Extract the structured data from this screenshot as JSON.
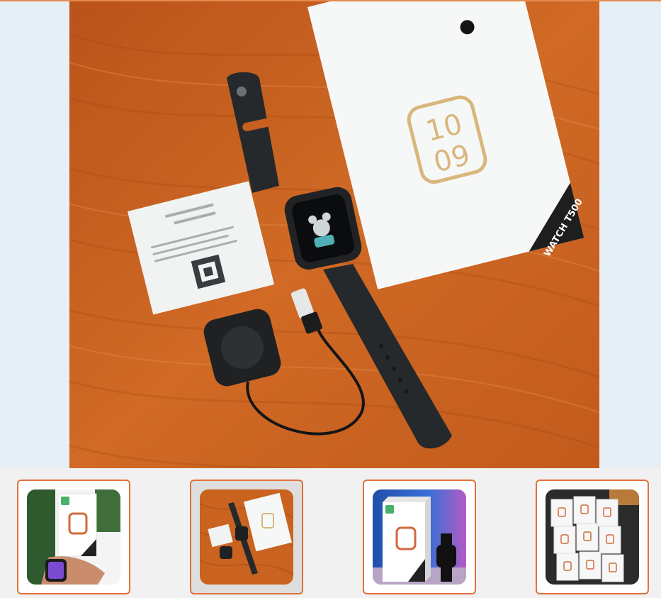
{
  "gallery": {
    "selected_index": 1,
    "main_image": {
      "box_label": "WATCH T500",
      "box_clock_top": "10",
      "box_clock_bottom": "09"
    },
    "thumbnails": [
      {
        "icon": "thumbnail-watch-on-wrist"
      },
      {
        "icon": "thumbnail-watch-flatlay"
      },
      {
        "icon": "thumbnail-watch-box-blue"
      },
      {
        "icon": "thumbnail-watch-boxes-stack"
      }
    ]
  },
  "colors": {
    "accent": "#e2703a",
    "hero_background": "#e6eef6",
    "wood": "#c8601e",
    "page": "#f1f1f1"
  }
}
